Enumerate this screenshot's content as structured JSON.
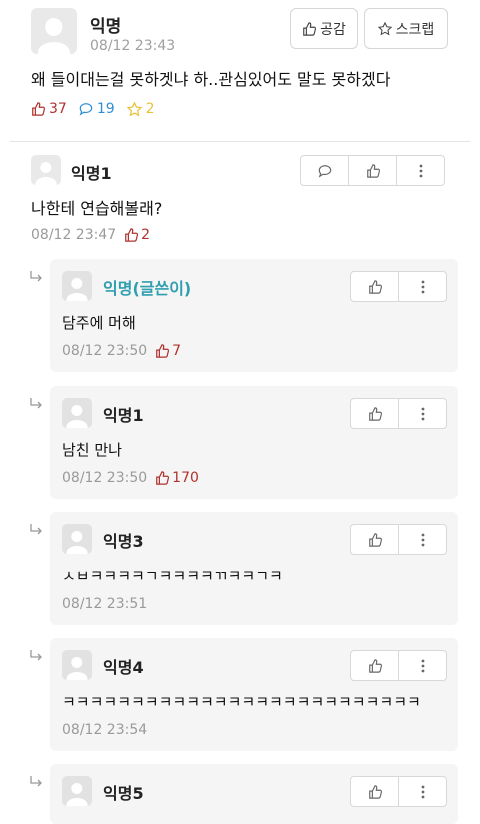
{
  "post": {
    "author": "익명",
    "timestamp": "08/12 23:43",
    "content": "왜 들이대는걸 못하겟냐 하..관심있어도 말도 못하겠다",
    "likes": "37",
    "comments": "19",
    "scraps": "2",
    "like_button_label": "공감",
    "scrap_button_label": "스크랩"
  },
  "colors": {
    "vote_red": "#b0312d",
    "comment_blue": "#2f8fd3",
    "scrap_yellow": "#e7c236",
    "op_teal": "#2f9fb0"
  },
  "comments": [
    {
      "author": "익명1",
      "content": "나한테 연습해볼래?",
      "timestamp": "08/12 23:47",
      "votes": "2"
    }
  ],
  "replies": [
    {
      "author": "익명(글쓴이)",
      "content": "담주에 머해",
      "timestamp": "08/12 23:50",
      "votes": "7",
      "is_op": true
    },
    {
      "author": "익명1",
      "content": "남친 만나",
      "timestamp": "08/12 23:50",
      "votes": "170"
    },
    {
      "author": "익명3",
      "content": "ㅅㅂㅋㅋㅋㅋㄱㅋㅋㅋㅋㄲㅋㅋㄱㅋ",
      "timestamp": "08/12 23:51",
      "votes": ""
    },
    {
      "author": "익명4",
      "content": "ㅋㅋㅋㅋㅋㅋㅋㅋㅋㅋㅋㅋㅋㅋㅋㅋㅋㅋㅋㅋㅋㅋㅋㅋㅋㅋ",
      "timestamp": "08/12 23:54",
      "votes": ""
    },
    {
      "author": "익명5",
      "content": "",
      "timestamp": "",
      "votes": ""
    }
  ]
}
